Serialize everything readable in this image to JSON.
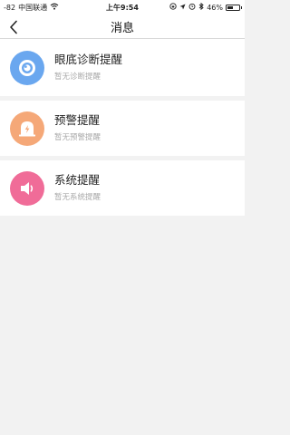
{
  "status_bar": {
    "signal": "-82",
    "carrier": "中国联通",
    "time": "上午9:54",
    "battery": "46%",
    "battery_level": 0.46
  },
  "nav": {
    "title": "消息",
    "back_icon": "chevron-left-icon"
  },
  "messages": [
    {
      "title": "眼底诊断提醒",
      "subtitle": "暂无诊断提醒",
      "icon": "eye-icon",
      "color": "#6aa7ef"
    },
    {
      "title": "预警提醒",
      "subtitle": "暂无预警提醒",
      "icon": "alarm-icon",
      "color": "#f5a878"
    },
    {
      "title": "系统提醒",
      "subtitle": "暂无系统提醒",
      "icon": "speaker-icon",
      "color": "#f06c98"
    }
  ]
}
